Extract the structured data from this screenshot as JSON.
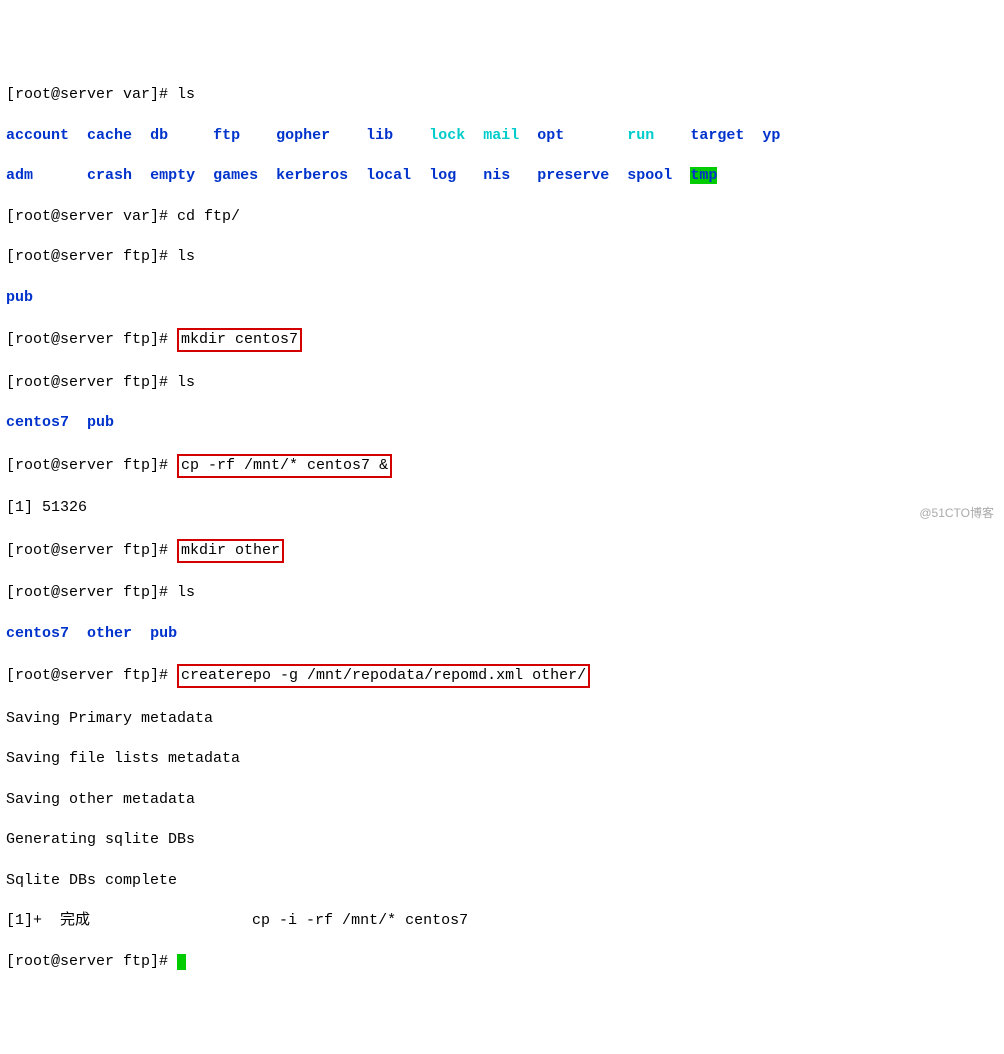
{
  "p1": "[root@server var]# ",
  "c1": "ls",
  "ls_var": {
    "r1": [
      {
        "t": "account",
        "c": "blue"
      },
      {
        "t": "cache",
        "c": "blue"
      },
      {
        "t": "db",
        "c": "blue"
      },
      {
        "t": "ftp",
        "c": "blue"
      },
      {
        "t": "gopher",
        "c": "blue"
      },
      {
        "t": "lib",
        "c": "blue"
      },
      {
        "t": "lock",
        "c": "cyan"
      },
      {
        "t": "mail",
        "c": "cyan"
      },
      {
        "t": "opt",
        "c": "blue"
      },
      {
        "t": "run",
        "c": "cyan"
      },
      {
        "t": "target",
        "c": "blue"
      },
      {
        "t": "yp",
        "c": "blue"
      }
    ],
    "r2": [
      {
        "t": "adm",
        "c": "blue"
      },
      {
        "t": "crash",
        "c": "blue"
      },
      {
        "t": "empty",
        "c": "blue"
      },
      {
        "t": "games",
        "c": "blue"
      },
      {
        "t": "kerberos",
        "c": "blue"
      },
      {
        "t": "local",
        "c": "blue"
      },
      {
        "t": "log",
        "c": "blue"
      },
      {
        "t": "nis",
        "c": "blue"
      },
      {
        "t": "preserve",
        "c": "blue"
      },
      {
        "t": "spool",
        "c": "blue"
      },
      {
        "t": "tmp",
        "c": "hl-green"
      }
    ]
  },
  "p2": "[root@server var]# ",
  "c2": "cd ftp/",
  "p3": "[root@server ftp]# ",
  "c3": "ls",
  "ls1": "pub",
  "p4": "[root@server ftp]# ",
  "c4": "mkdir centos7",
  "p5": "[root@server ftp]# ",
  "c5": "ls",
  "ls2a": "centos7",
  "ls2b": "pub",
  "p6": "[root@server ftp]# ",
  "c6": "cp -rf /mnt/* centos7 &",
  "job1": "[1] 51326",
  "p7": "[root@server ftp]# ",
  "c7": "mkdir other",
  "p8": "[root@server ftp]# ",
  "c8": "ls",
  "ls3a": "centos7",
  "ls3b": "other",
  "ls3c": "pub",
  "p9": "[root@server ftp]# ",
  "c9": "createrepo -g /mnt/repodata/repomd.xml other/",
  "out1": "Saving Primary metadata",
  "out2": "Saving file lists metadata",
  "out3": "Saving other metadata",
  "out4": "Generating sqlite DBs",
  "out5": "Sqlite DBs complete",
  "job2_a": "[1]+  完成",
  "job2_b": "cp -i -rf /mnt/* centos7",
  "p10": "[root@server ftp]# ",
  "watermark": "@51CTO博客"
}
